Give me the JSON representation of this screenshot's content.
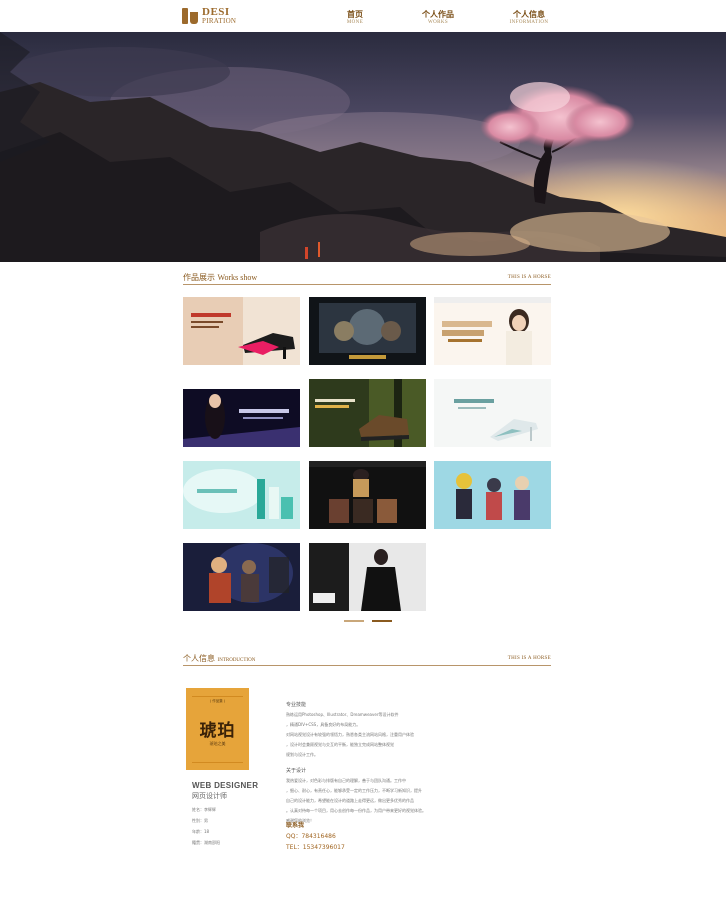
{
  "header": {
    "logo_main": "DESI",
    "logo_sub": "PIRATION",
    "nav": [
      {
        "zh": "首页",
        "en": "MONE"
      },
      {
        "zh": "个人作品",
        "en": "WORKS"
      },
      {
        "zh": "个人信息",
        "en": "INFORMATION"
      }
    ]
  },
  "works": {
    "title_zh": "作品展示",
    "title_en": "Works show",
    "right_label": "THIS IS A HORSE"
  },
  "colors": {
    "accent": "#8a5a1f",
    "nav_text": "#7a4e16",
    "divider": "#b8956a",
    "pager_active": "#8a5a1f",
    "pager_inactive": "#c9a77a",
    "profile_card": "#e6a43a"
  },
  "info": {
    "title_zh": "个人信息",
    "title_en": "INTRODUCTION",
    "right_label": "THIS IS A HORSE",
    "card_chars": "琥珀",
    "card_sub": "琥珀之美",
    "card_top": "( 作品集 )",
    "web_designer": "WEB DESIGNER",
    "web_designer_zh": "网页设计师",
    "facts": [
      "姓名：李辉辉",
      "性别：男",
      "年龄：18",
      "籍贯：湖南邵阳"
    ],
    "skills_heading": "专业技能",
    "skills_text": [
      "熟练运用Photoshop、Illustrator、Dreamweaver等设计软件",
      "，精通DIV+CSS，具备良好的布局能力。",
      "对网站视觉设计有较强的领悟力，熟悉各类主流网站风格，注重用户体验",
      "，设计时会兼顾视觉与交互的平衡，能独立完成网站整体视觉",
      "规划与设计工作。"
    ],
    "about_heading": "关于设计",
    "about_text": [
      "我热爱设计，对色彩与排版有自己的理解，善于与团队沟通。工作中",
      "，细心、耐心，有责任心，能够承受一定的工作压力，不断学习新知识，提升",
      "自己的设计能力，希望能在设计的道路上走得更远，做出更多优秀的作品",
      "。认真对待每一个项目，用心去创作每一份作品，为用户带来更好的视觉体验。",
      "感谢您的浏览！"
    ],
    "contact_heading": "联系我",
    "qq": "QQ：784316486",
    "tel": "TEL：15347396017"
  }
}
